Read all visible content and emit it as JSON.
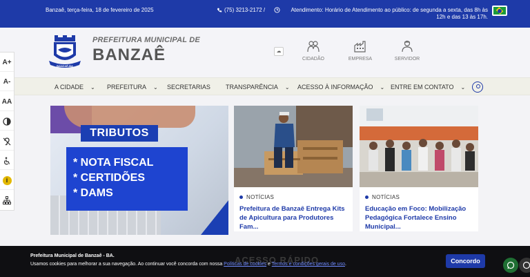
{
  "topbar": {
    "date": "Banzaê, terça-feira, 18 de fevereiro de 2025",
    "phone": "(75) 3213-2172 /",
    "hours_label": "Atendimento:",
    "hours_text": "Horário de Atendimento ao público: de segunda a sexta, das 8h às 12h e das 13 às 17h."
  },
  "brand": {
    "top": "PREFEITURA MUNICIPAL DE",
    "main": "BANZAÊ",
    "crest_text": "BANZAÊ-BA"
  },
  "quick_links": [
    "CIDADÃO",
    "EMPRESA",
    "SERVIDOR"
  ],
  "nav": [
    {
      "label": "A CIDADE",
      "has_menu": true
    },
    {
      "label": "PREFEITURA",
      "has_menu": true
    },
    {
      "label": "SECRETARIAS",
      "has_menu": false
    },
    {
      "label": "TRANSPARÊNCIA",
      "has_menu": true
    },
    {
      "label": "ACESSO À INFORMAÇÃO",
      "has_menu": true
    },
    {
      "label": "ENTRE EM CONTATO",
      "has_menu": true
    }
  ],
  "accessibility": [
    "A+",
    "A-",
    "AA",
    "contrast-icon",
    "hearing-icon",
    "wheelchair-icon",
    "info-icon",
    "sitemap-icon"
  ],
  "banner": {
    "title": "TRIBUTOS",
    "lines": [
      "* NOTA FISCAL",
      "* CERTIDÕES",
      "* DAMS"
    ]
  },
  "news": [
    {
      "tag": "NOTÍCIAS",
      "title": "Prefeitura de Banzaê Entrega Kits de Apicultura para Produtores Fam..."
    },
    {
      "tag": "NOTÍCIAS",
      "title": "Educação em Foco: Mobilização Pedagógica Fortalece Ensino Municipal..."
    }
  ],
  "section_heading": "ACESSO RÁPIDO",
  "cookie": {
    "title": "Prefeitura Municipal de Banzaê - BA.",
    "text_before": "Usamos cookies para melhorar a sua navegação. Ao continuar você concorda com nossa",
    "link1": "Políticas de cookies",
    "and": "e",
    "link2": "Termos e condições gerais de uso",
    "end": ".",
    "button": "Concordo"
  },
  "colors": {
    "primary": "#1e3aa8",
    "cookie_bg": "#0f0f12"
  }
}
